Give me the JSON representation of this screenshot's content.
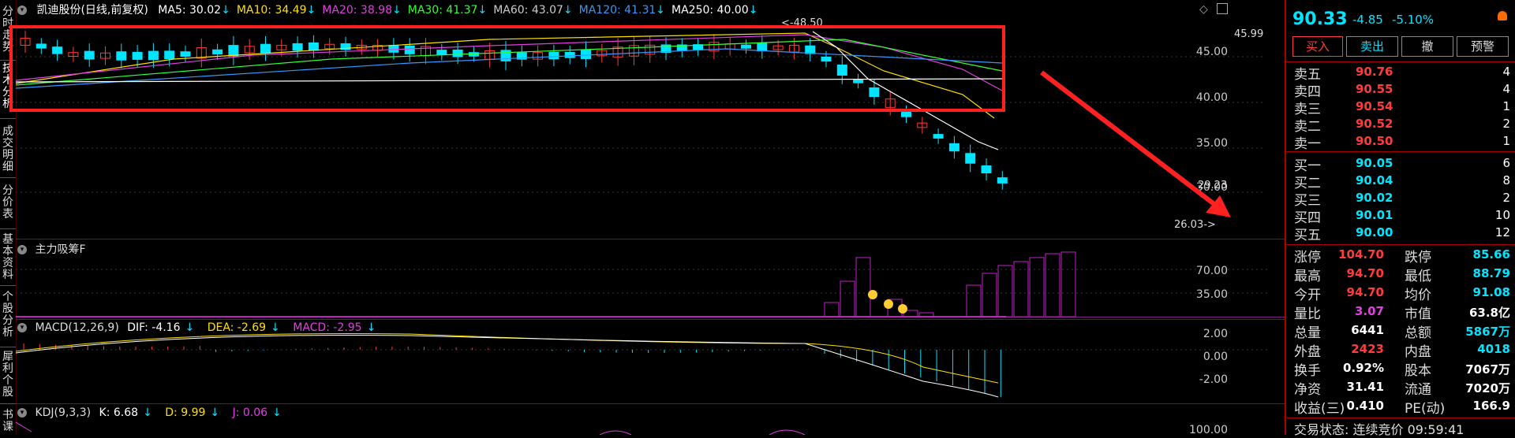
{
  "left_tabs": [
    "分时走势",
    "技术分析",
    "成交明细",
    "分价表",
    "基本资料",
    "个股分析",
    "犀利个股",
    "书课"
  ],
  "ma_bar": {
    "title": "凯迪股份(日线,前复权)",
    "items": [
      {
        "label": "MA5: 30.02",
        "color": "#ffffff"
      },
      {
        "label": "MA10: 34.49",
        "color": "#ffe000"
      },
      {
        "label": "MA20: 38.98",
        "color": "#e040e0"
      },
      {
        "label": "MA30: 41.37",
        "color": "#33ff33"
      },
      {
        "label": "MA60: 43.07",
        "color": "#cccccc"
      },
      {
        "label": "MA120: 41.31",
        "color": "#3399ff"
      },
      {
        "label": "MA250: 40.00",
        "color": "#ffffff"
      }
    ],
    "arrow": "↓"
  },
  "main_axis": [
    "45.00",
    "40.00",
    "35.00",
    "30.00"
  ],
  "annotations": {
    "high": "48.50",
    "right_top": "45.99",
    "low": "26.03",
    "last": "29.23"
  },
  "inflow": {
    "title": "主力吸筹F",
    "axis": [
      "70.00",
      "35.00"
    ]
  },
  "macd": {
    "title": "MACD(12,26,9)",
    "dif": "DIF: -4.16",
    "dea": "DEA: -2.69",
    "macd": "MACD: -2.95",
    "axis": [
      "2.00",
      "0.00",
      "-2.00"
    ]
  },
  "kdj": {
    "title": "KDJ(9,3,3)",
    "k": "K: 6.68",
    "d": "D: 9.99",
    "j": "J: 0.06",
    "axis": [
      "100.00"
    ]
  },
  "quote": {
    "price": "90.33",
    "change": "-4.85",
    "pct": "-5.10%",
    "buttons": [
      "买入",
      "卖出",
      "撤",
      "预警"
    ],
    "asks": [
      {
        "label": "卖五",
        "price": "90.76",
        "vol": "4"
      },
      {
        "label": "卖四",
        "price": "90.55",
        "vol": "4"
      },
      {
        "label": "卖三",
        "price": "90.54",
        "vol": "1"
      },
      {
        "label": "卖二",
        "price": "90.52",
        "vol": "2"
      },
      {
        "label": "卖一",
        "price": "90.50",
        "vol": "1"
      }
    ],
    "bids": [
      {
        "label": "买一",
        "price": "90.05",
        "vol": "6"
      },
      {
        "label": "买二",
        "price": "90.04",
        "vol": "8"
      },
      {
        "label": "买三",
        "price": "90.02",
        "vol": "2"
      },
      {
        "label": "买四",
        "price": "90.01",
        "vol": "10"
      },
      {
        "label": "买五",
        "price": "90.00",
        "vol": "12"
      }
    ],
    "stats": [
      {
        "l1": "涨停",
        "v1": "104.70",
        "c1": "#ff3b3b",
        "l2": "跌停",
        "v2": "85.66",
        "c2": "#00e5ff"
      },
      {
        "l1": "最高",
        "v1": "94.70",
        "c1": "#ff3b3b",
        "l2": "最低",
        "v2": "88.79",
        "c2": "#00e5ff"
      },
      {
        "l1": "今开",
        "v1": "94.70",
        "c1": "#ff3b3b",
        "l2": "均价",
        "v2": "91.08",
        "c2": "#00e5ff"
      },
      {
        "l1": "量比",
        "v1": "3.07",
        "c1": "#e040e0",
        "l2": "市值",
        "v2": "63.8亿",
        "c2": "#ffffff"
      },
      {
        "l1": "总量",
        "v1": "6441",
        "c1": "#ffffff",
        "l2": "总额",
        "v2": "5867万",
        "c2": "#00e5ff"
      },
      {
        "l1": "外盘",
        "v1": "2423",
        "c1": "#ff3b3b",
        "l2": "内盘",
        "v2": "4018",
        "c2": "#00e5ff"
      },
      {
        "l1": "换手",
        "v1": "0.92%",
        "c1": "#ffffff",
        "l2": "股本",
        "v2": "7067万",
        "c2": "#ffffff"
      },
      {
        "l1": "净资",
        "v1": "31.41",
        "c1": "#ffffff",
        "l2": "流通",
        "v2": "7020万",
        "c2": "#ffffff"
      },
      {
        "l1": "收益(三)",
        "v1": "0.410",
        "c1": "#ffffff",
        "l2": "PE(动)",
        "v2": "166.9",
        "c2": "#ffffff"
      }
    ],
    "status": "交易状态: 连续竞价 09:59:41"
  },
  "colors": {
    "up": "#ff3b3b",
    "down": "#00e5ff",
    "highlight": "#ff2020"
  }
}
